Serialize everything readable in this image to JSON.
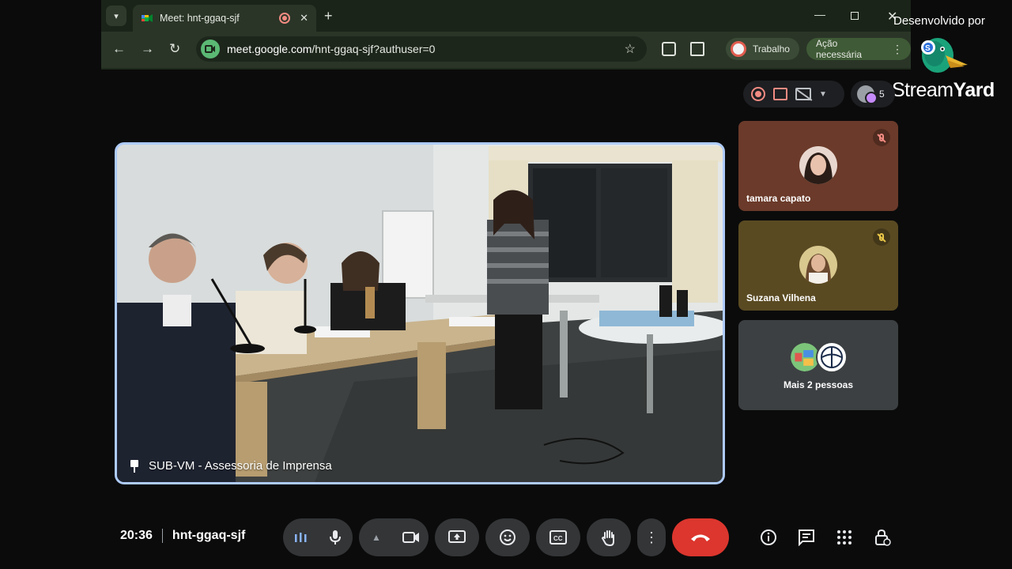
{
  "browser": {
    "tab_title": "Meet: hnt-ggaq-sjf",
    "url_host": "meet.google.com",
    "url_path": "/hnt-ggaq-sjf?authuser=0",
    "profile_label": "Trabalho",
    "action_label": "Ação necessária"
  },
  "streamyard": {
    "developed_by": "Desenvolvido por",
    "brand_light": "Stream",
    "brand_bold": "Yard"
  },
  "meet": {
    "participant_count": "5",
    "pinned_name": "SUB-VM - Assessoria de Imprensa",
    "tiles": [
      {
        "name": "tamara capato",
        "muted": true
      },
      {
        "name": "Suzana Vilhena",
        "muted": true
      }
    ],
    "more_label": "Mais 2 pessoas",
    "time": "20:36",
    "meeting_code": "hnt-ggaq-sjf"
  },
  "colors": {
    "end_call": "#dc362e",
    "pinned_border": "#aecbfa",
    "recording": "#f28b82"
  },
  "icons": [
    "tab-menu-icon",
    "meet-favicon",
    "recording-icon",
    "close-icon",
    "new-tab-icon",
    "minimize-icon",
    "maximize-icon",
    "window-close-icon",
    "back-icon",
    "forward-icon",
    "reload-icon",
    "site-info-icon",
    "bookmark-star-icon",
    "extension-icon",
    "puzzle-icon",
    "kebab-icon",
    "pin-icon",
    "mic-off-icon",
    "audio-levels-icon",
    "mic-icon",
    "chevron-up-icon",
    "camera-icon",
    "present-icon",
    "emoji-icon",
    "captions-icon",
    "raise-hand-icon",
    "more-options-icon",
    "end-call-icon",
    "info-icon",
    "chat-icon",
    "apps-icon",
    "host-controls-icon"
  ]
}
